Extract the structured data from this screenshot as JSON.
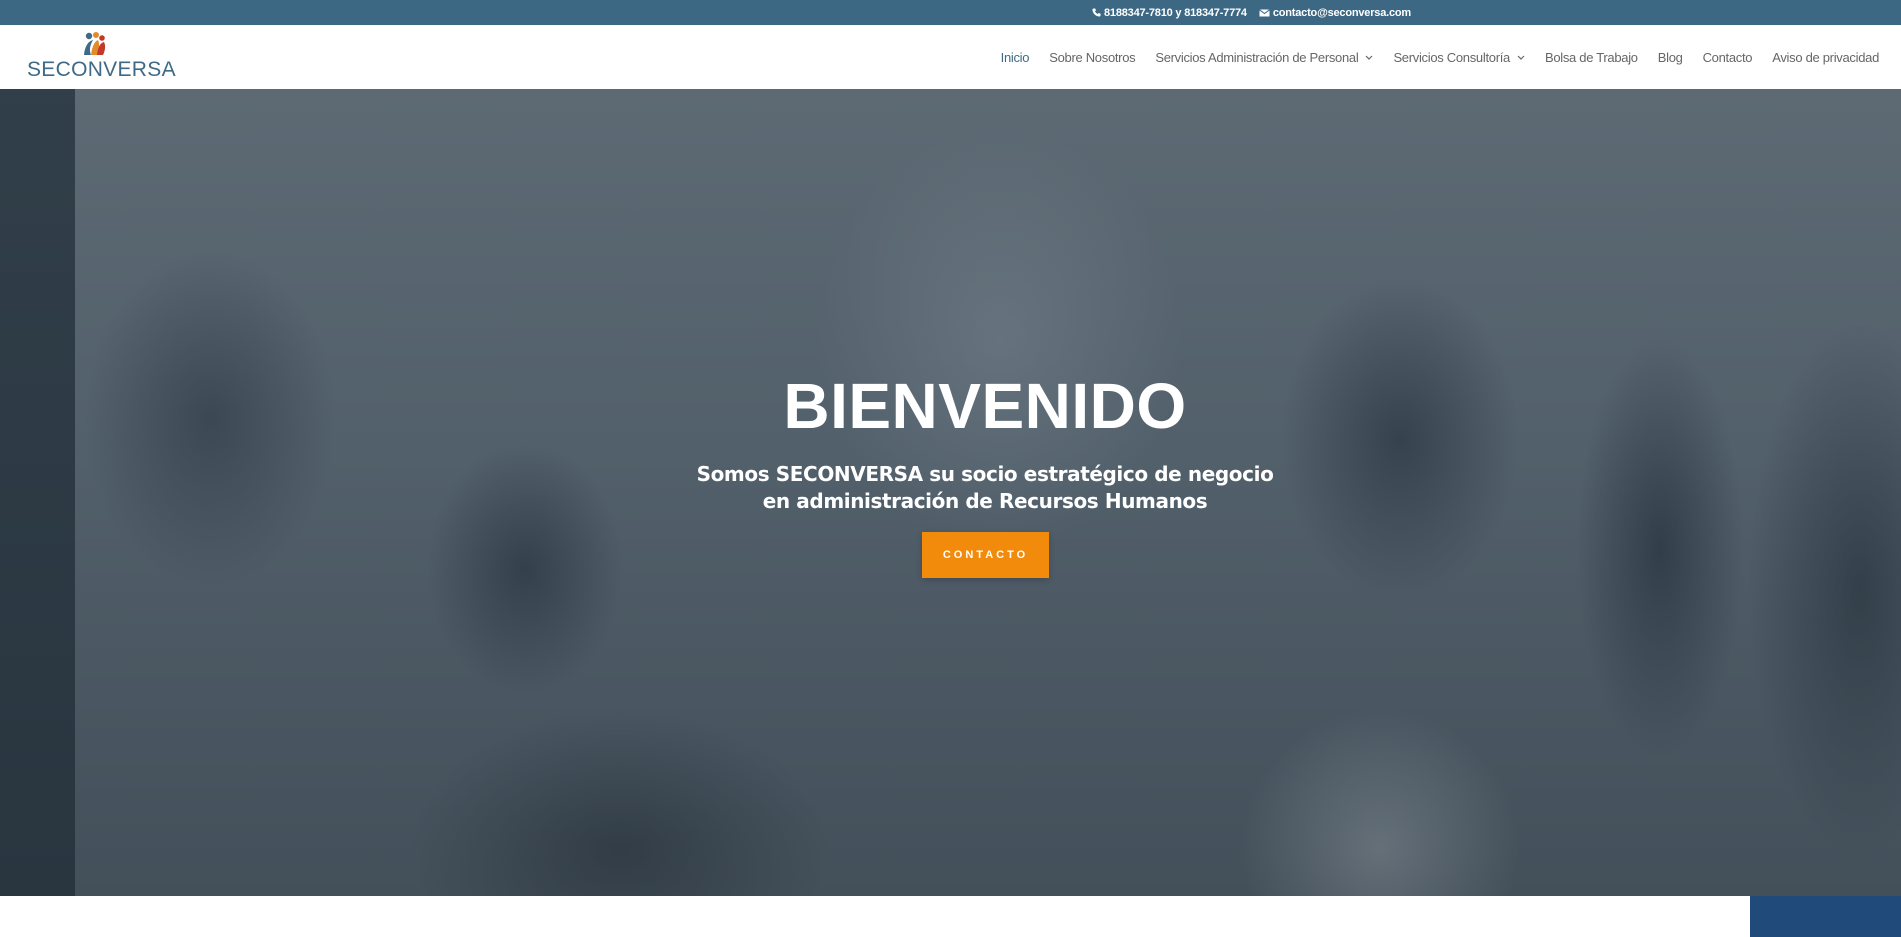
{
  "topbar": {
    "phone": "8188347-7810 y 818347-7774",
    "email": "contacto@seconversa.com",
    "phone_icon": "phone-icon",
    "email_icon": "envelope-icon"
  },
  "brand": {
    "name": "SECONVERSA",
    "logo_icon": "people-logo-icon"
  },
  "nav": {
    "items": [
      {
        "label": "Inicio"
      },
      {
        "label": "Sobre Nosotros"
      },
      {
        "label": "Servicios Administración de Personal"
      },
      {
        "label": "Servicios Consultoría"
      },
      {
        "label": "Bolsa de Trabajo"
      },
      {
        "label": "Blog"
      },
      {
        "label": "Contacto"
      },
      {
        "label": "Aviso de privacidad"
      }
    ],
    "dropdown_icon": "chevron-down-icon"
  },
  "hero": {
    "title": "BIENVENIDO",
    "subtitle_line1": "Somos SECONVERSA su socio estratégico de negocio",
    "subtitle_line2": "en administración de Recursos Humanos",
    "cta_label": "CONTACTO"
  },
  "colors": {
    "topbar": "#3d6884",
    "brand": "#3f6a87",
    "cta": "#f28b0c",
    "corner_block": "#1f4a7a"
  }
}
